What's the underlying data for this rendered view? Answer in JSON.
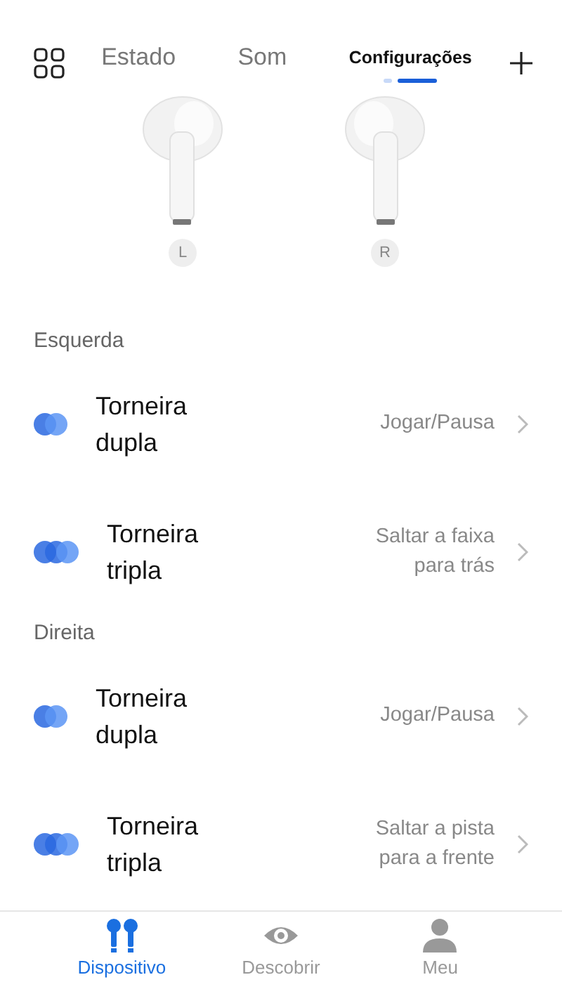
{
  "tabs": [
    {
      "label": "Estado",
      "selected": false
    },
    {
      "label": "Som",
      "selected": false
    },
    {
      "label": "Configurações",
      "selected": true
    }
  ],
  "earbuds": [
    {
      "side": "L"
    },
    {
      "side": "R"
    }
  ],
  "sections": [
    {
      "title": "Esquerda",
      "rows": [
        {
          "kind": "double",
          "label_lines": [
            "Torneira",
            "dupla"
          ],
          "action_lines": [
            "Jogar/Pausa"
          ]
        },
        {
          "kind": "triple",
          "label_lines": [
            "Torneira",
            "tripla"
          ],
          "action_lines": [
            "Saltar a faixa",
            "para trás"
          ]
        }
      ]
    },
    {
      "title": "Direita",
      "rows": [
        {
          "kind": "double",
          "label_lines": [
            "Torneira",
            "dupla"
          ],
          "action_lines": [
            "Jogar/Pausa"
          ]
        },
        {
          "kind": "triple",
          "label_lines": [
            "Torneira",
            "tripla"
          ],
          "action_lines": [
            "Saltar a pista",
            "para a frente"
          ]
        }
      ]
    }
  ],
  "nav": [
    {
      "label": "Dispositivo",
      "selected": true,
      "kind": "device"
    },
    {
      "label": "Descobrir",
      "selected": false,
      "kind": "discover"
    },
    {
      "label": "Meu",
      "selected": false,
      "kind": "me"
    }
  ]
}
